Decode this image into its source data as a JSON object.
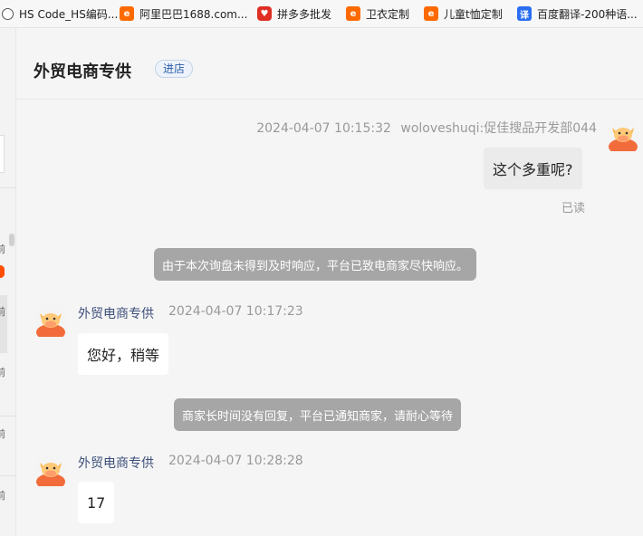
{
  "bookmarks": [
    {
      "label": "HS Code_HS编码...",
      "icon": "globe-icon"
    },
    {
      "label": "阿里巴巴1688.com...",
      "icon": "alibaba-icon"
    },
    {
      "label": "拼多多批发",
      "icon": "pinduoduo-icon"
    },
    {
      "label": "卫衣定制",
      "icon": "alibaba-icon"
    },
    {
      "label": "儿童t恤定制",
      "icon": "alibaba-icon"
    },
    {
      "label": "百度翻译-200种语...",
      "icon": "baidu-translate-icon"
    }
  ],
  "header": {
    "title": "外贸电商专供",
    "enter_shop": "进店"
  },
  "messages": [
    {
      "type": "outgoing",
      "timestamp": "2024-04-07 10:15:32",
      "sender": "woloveshuqi:促佳搜品开发部044",
      "text": "这个多重呢?",
      "status": "已读"
    },
    {
      "type": "system",
      "text": "由于本次询盘未得到及时响应，平台已致电商家尽快响应。"
    },
    {
      "type": "incoming",
      "sender": "外贸电商专供",
      "timestamp": "2024-04-07 10:17:23",
      "text": "您好，稍等"
    },
    {
      "type": "system",
      "text": "商家长时间没有回复，平台已通知商家，请耐心等待"
    },
    {
      "type": "incoming",
      "sender": "外贸电商专供",
      "timestamp": "2024-04-07 10:28:28",
      "text": "17"
    }
  ],
  "colors": {
    "alibaba_orange": "#ff6a00",
    "avatar_red": "#f26b3a",
    "system_bubble": "#a6a6a6",
    "sender_name": "#3d4f7a"
  }
}
